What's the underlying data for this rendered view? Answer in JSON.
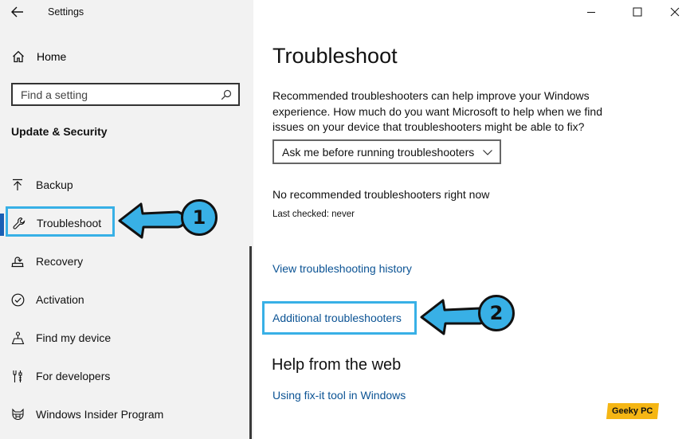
{
  "window": {
    "app_title": "Settings",
    "controls": {
      "minimize": "minimize-icon",
      "maximize": "maximize-icon",
      "close": "close-icon"
    }
  },
  "sidebar": {
    "home_label": "Home",
    "search": {
      "placeholder": "Find a setting",
      "value": ""
    },
    "section_title": "Update & Security",
    "items": [
      {
        "label": "Backup",
        "icon": "backup-arrow-icon",
        "active": false
      },
      {
        "label": "Troubleshoot",
        "icon": "wrench-icon",
        "active": true
      },
      {
        "label": "Recovery",
        "icon": "recovery-icon",
        "active": false
      },
      {
        "label": "Activation",
        "icon": "check-circle-icon",
        "active": false
      },
      {
        "label": "Find my device",
        "icon": "find-device-icon",
        "active": false
      },
      {
        "label": "For developers",
        "icon": "developer-tools-icon",
        "active": false
      },
      {
        "label": "Windows Insider Program",
        "icon": "insider-cat-icon",
        "active": false
      }
    ]
  },
  "main": {
    "title": "Troubleshoot",
    "description": "Recommended troubleshooters can help improve your Windows experience. How much do you want Microsoft to help when we find issues on your device that troubleshooters might be able to fix?",
    "dropdown": {
      "selected": "Ask me before running troubleshooters"
    },
    "no_recommended": "No recommended troubleshooters right now",
    "last_checked": "Last checked: never",
    "links": {
      "history": "View troubleshooting history",
      "additional": "Additional troubleshooters"
    },
    "help_heading": "Help from the web",
    "help_link": "Using fix-it tool in Windows"
  },
  "annotations": {
    "step1": "1",
    "step2": "2",
    "accent_color": "#38b0e6"
  },
  "watermark": "Geeky PC"
}
